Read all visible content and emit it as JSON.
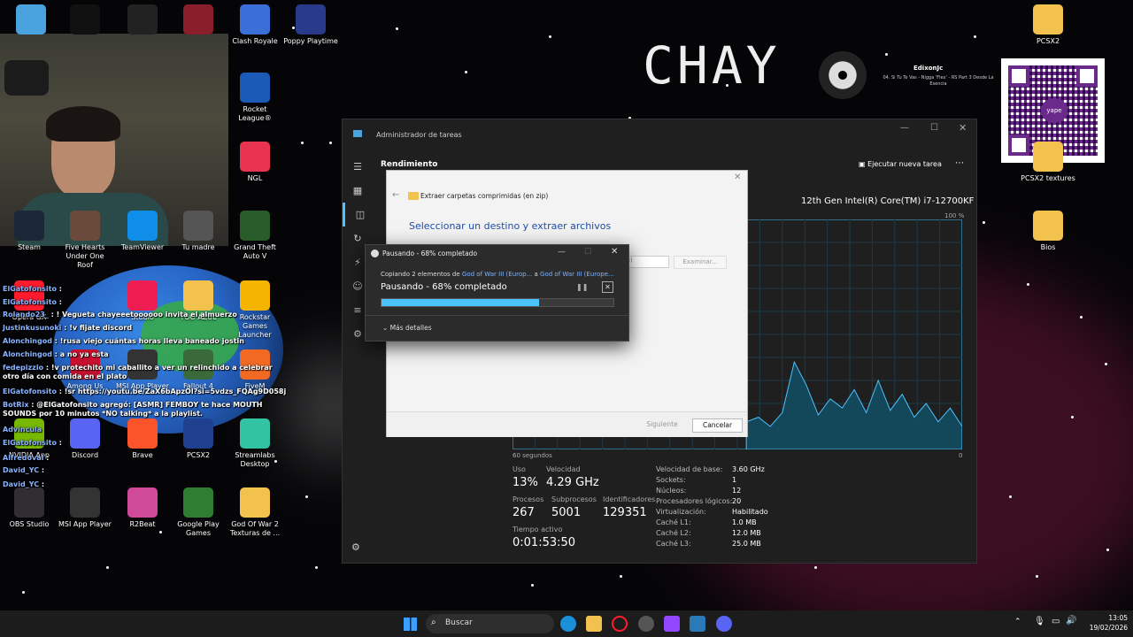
{
  "desktop": {
    "icons": [
      {
        "label": "",
        "x_icon": "recycle-bin-icon",
        "color": "#4aa3df"
      },
      {
        "label": "",
        "x_icon": "epic-games-icon",
        "color": "#111111"
      },
      {
        "label": "",
        "x_icon": "roblox-icon",
        "color": "#222222"
      },
      {
        "label": "",
        "x_icon": "game-icon",
        "color": "#8b1e2b"
      },
      {
        "label": "Clash Royale",
        "x_icon": "clash-royale-icon",
        "color": "#3a6fd8"
      },
      {
        "label": "Poppy Playtime",
        "x_icon": "poppy-playtime-icon",
        "color": "#2a3a8a"
      },
      {
        "label": "Rocket League®",
        "x_icon": "rocket-league-icon",
        "color": "#1c5ab8"
      },
      {
        "label": "NGL",
        "x_icon": "ngl-icon",
        "color": "#e8344e"
      },
      {
        "label": "Grand Theft Auto V",
        "x_icon": "gta-v-icon",
        "color": "#2a5c2a"
      },
      {
        "label": "Rockstar Games Launcher",
        "x_icon": "rockstar-icon",
        "color": "#f4b400"
      },
      {
        "label": "FiveM",
        "x_icon": "fivem-icon",
        "color": "#f06a24"
      },
      {
        "label": "Fallout 4",
        "x_icon": "fallout-icon",
        "color": "#3a6a3a"
      },
      {
        "label": "MSI App Player",
        "x_icon": "msi-app-player-icon",
        "color": "#333333"
      },
      {
        "label": "Among Us",
        "x_icon": "among-us-icon",
        "color": "#c8102e"
      },
      {
        "label": "Discord",
        "x_icon": "discord-icon",
        "color": "#5865f2"
      },
      {
        "label": "Brave",
        "x_icon": "brave-icon",
        "color": "#fb542b"
      },
      {
        "label": "PCSX2",
        "x_icon": "pcsx2-icon",
        "color": "#1f3f8f"
      },
      {
        "label": "Streamlabs Desktop",
        "x_icon": "streamlabs-icon",
        "color": "#31c3a2"
      },
      {
        "label": "OBS Studio",
        "x_icon": "obs-icon",
        "color": "#302e31"
      },
      {
        "label": "MSI App Player",
        "x_icon": "msi-app-player-icon",
        "color": "#333333"
      },
      {
        "label": "R2Beat",
        "x_icon": "r2beat-icon",
        "color": "#d04a9a"
      },
      {
        "label": "Google Play Games",
        "x_icon": "google-play-games-icon",
        "color": "#2e7d32"
      },
      {
        "label": "God Of War 2 Texturas de ...",
        "x_icon": "folder-icon",
        "color": "#f2c14e"
      },
      {
        "label": "PCSX2",
        "x_icon": "folder-icon",
        "color": "#f2c14e"
      },
      {
        "label": "PCSX2 textures",
        "x_icon": "folder-icon",
        "color": "#f2c14e"
      },
      {
        "label": "Bios",
        "x_icon": "folder-icon",
        "color": "#f2c14e"
      },
      {
        "label": "Opera GX",
        "x_icon": "opera-gx-icon",
        "color": "#ff1b2d"
      },
      {
        "label": "Steam",
        "x_icon": "steam-icon",
        "color": "#1b2838"
      },
      {
        "label": "Five Hearts Under One Roof",
        "x_icon": "game-icon",
        "color": "#6a4a3a"
      },
      {
        "label": "TeamViewer",
        "x_icon": "teamviewer-icon",
        "color": "#0e8ee9"
      },
      {
        "label": "Tu madre",
        "x_icon": "game-icon",
        "color": "#555555"
      },
      {
        "label": "Studio",
        "x_icon": "tiktok-icon",
        "color": "#ee1d52"
      },
      {
        "label": "NVIDIA App",
        "x_icon": "nvidia-icon",
        "color": "#76b900"
      },
      {
        "label": "TOO AZUL",
        "x_icon": "folder-icon",
        "color": "#f2c14e"
      }
    ],
    "overlay": {
      "brand": "CHAY",
      "music_artist": "EdixonJc",
      "music_track": "04. Si Tu Te Vas - Nigga 'Flex' - RS Part 3 Desde La Esencia",
      "qr_label": "yape"
    }
  },
  "chat": [
    {
      "user": "ElGatofonsito",
      "msg": ":"
    },
    {
      "user": "ElGatofonsito",
      "msg": ":"
    },
    {
      "user": "Rolando23_",
      "msg": ": ! Vegueta chayeeetoooooo invita el almuerzo"
    },
    {
      "user": "Justinkusunoki",
      "msg": ": !v fijate discord"
    },
    {
      "user": "Alonchingod",
      "msg": ": !rusa viejo cuántas horas lleva baneado jostin"
    },
    {
      "user": "Alonchingod",
      "msg": ": a no ya esta"
    },
    {
      "user": "fedepizzio",
      "msg": ": !v protechito mi caballito a ver un relinchido a celebrar otro día con comida en el plato"
    },
    {
      "user": "ElGatofonsito",
      "msg": ": !sr https://youtu.be/ZaX6bApzOl?si=5vdzs_FQAg9D058j"
    },
    {
      "user": "BotRix",
      "msg": ": @ElGatofonsito agregó: [ASMR] FEMBOY te hace MOUTH SOUNDS por 10 minutos *NO talking* a la playlist."
    },
    {
      "user": "Advincula",
      "msg": ""
    },
    {
      "user": "ElGatofonsito",
      "msg": ":"
    },
    {
      "user": "Alfredoval",
      "msg": ":"
    },
    {
      "user": "David_YC",
      "msg": ":"
    },
    {
      "user": "David_YC",
      "msg": ":"
    }
  ],
  "task_manager": {
    "title": "Administrador de tareas",
    "section": "Rendimiento",
    "run_task_label": "Ejecutar nueva tarea",
    "cpu_name": "12th Gen Intel(R) Core(TM) i7-12700KF",
    "pct_max": "100 %",
    "time_left": "60 segundos",
    "time_right": "0",
    "uso_label": "Uso",
    "uso": "13%",
    "vel_label": "Velocidad",
    "vel": "4.29 GHz",
    "proc_label": "Procesos",
    "proc": "267",
    "sub_label": "Subprocesos",
    "sub": "5001",
    "ident_label": "Identificadores",
    "ident": "129351",
    "uptime_label": "Tiempo activo",
    "uptime": "0:01:53:50",
    "details": [
      {
        "k": "Velocidad de base:",
        "v": "3.60 GHz"
      },
      {
        "k": "Sockets:",
        "v": "1"
      },
      {
        "k": "Núcleos:",
        "v": "12"
      },
      {
        "k": "Procesadores lógicos:",
        "v": "20"
      },
      {
        "k": "Virtualización:",
        "v": "Habilitado"
      },
      {
        "k": "Caché L1:",
        "v": "1.0 MB"
      },
      {
        "k": "Caché L2:",
        "v": "12.0 MB"
      },
      {
        "k": "Caché L3:",
        "v": "25.0 MB"
      }
    ],
    "graph_values": [
      12,
      14,
      10,
      16,
      38,
      28,
      15,
      22,
      18,
      26,
      16,
      30,
      17,
      24,
      14,
      20,
      12,
      18,
      10
    ]
  },
  "extract_dialog": {
    "title": "Extraer carpetas comprimidas (en zip)",
    "heading": "Seleccionar un destino y extraer archivos",
    "partial_field": "Ru)",
    "browse_label": "Examinar...",
    "next_label": "Siguiente",
    "cancel_label": "Cancelar"
  },
  "copy_dialog": {
    "title": "Pausando - 68% completado",
    "desc_prefix": "Copiando 2 elementos de ",
    "source": "God of War III (Europ...",
    "desc_mid": " a ",
    "dest": "God of War III (Europe...",
    "status": "Pausando - 68% completado",
    "progress": 68,
    "more_label": "Más detalles"
  },
  "taskbar": {
    "search_placeholder": "Buscar",
    "time": "13:05",
    "date": "19/02/2026"
  }
}
